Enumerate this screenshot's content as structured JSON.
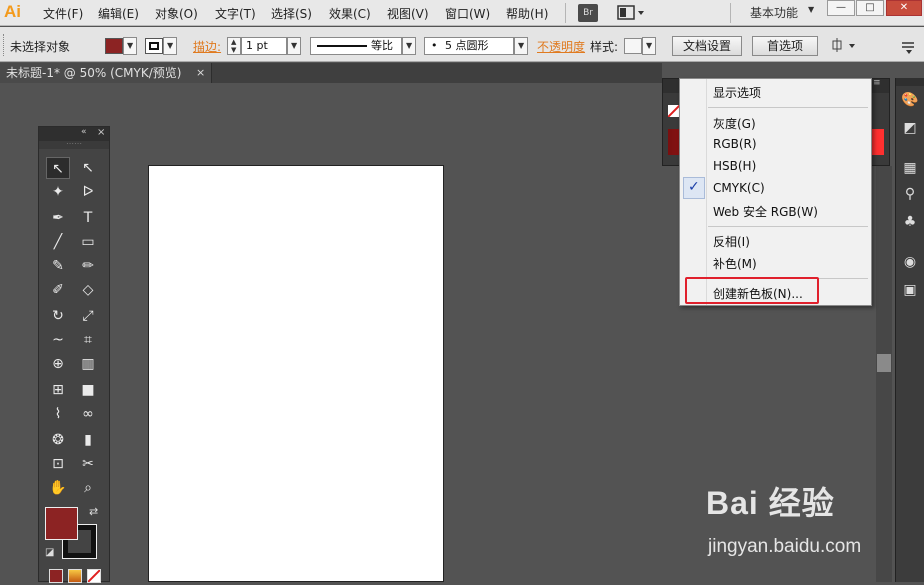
{
  "app": {
    "logo": "Ai"
  },
  "menubar": {
    "items": [
      "文件(F)",
      "编辑(E)",
      "对象(O)",
      "文字(T)",
      "选择(S)",
      "效果(C)",
      "视图(V)",
      "窗口(W)",
      "帮助(H)"
    ],
    "bridge_label": "Br",
    "workspace": "基本功能",
    "window_buttons": [
      "—",
      "□",
      "✕"
    ]
  },
  "control_bar": {
    "selection_status": "未选择对象",
    "fill_color": "#8c2323",
    "stroke_label": "描边:",
    "stroke_weight": "1 pt",
    "stroke_profile": "等比",
    "brush_label": "5 点圆形",
    "opacity_label": "不透明度",
    "style_label": "样式:",
    "doc_setup_button": "文档设置",
    "prefs_button": "首选项"
  },
  "document_tab": {
    "title": "未标题-1* @ 50% (CMYK/预览)",
    "close": "×"
  },
  "tools": {
    "rows": [
      [
        "selection-tool",
        "direct-selection-tool"
      ],
      [
        "magic-wand-tool",
        "lasso-tool"
      ],
      [
        "pen-tool",
        "type-tool"
      ],
      [
        "line-tool",
        "rectangle-tool"
      ],
      [
        "paintbrush-tool",
        "pencil-tool"
      ],
      [
        "blob-brush-tool",
        "eraser-tool"
      ],
      [
        "rotate-tool",
        "scale-tool"
      ],
      [
        "warp-tool",
        "free-transform-tool"
      ],
      [
        "shape-builder-tool",
        "graph-tool"
      ],
      [
        "mesh-tool",
        "gradient-tool"
      ],
      [
        "eyedropper-tool",
        "blend-tool"
      ],
      [
        "symbol-sprayer-tool",
        "column-graph-tool"
      ],
      [
        "artboard-tool",
        "slice-tool"
      ],
      [
        "hand-tool",
        "zoom-tool"
      ]
    ],
    "glyphs": [
      [
        "↖",
        "↖"
      ],
      [
        "✦",
        "ᐅ"
      ],
      [
        "✒",
        "T"
      ],
      [
        "╱",
        "▭"
      ],
      [
        "✎",
        "✏"
      ],
      [
        "✐",
        "◇"
      ],
      [
        "↻",
        "⤢"
      ],
      [
        "~",
        "⌗"
      ],
      [
        "⊕",
        "▥"
      ],
      [
        "⊞",
        "■"
      ],
      [
        "⌇",
        "∞"
      ],
      [
        "❂",
        "▮"
      ],
      [
        "⊡",
        "✂"
      ],
      [
        "✋",
        "⌕"
      ]
    ],
    "fill_color": "#8c2323",
    "stroke_color": "#111111"
  },
  "color_menu": {
    "items": [
      {
        "label": "显示选项"
      },
      {
        "label": "灰度(G)"
      },
      {
        "label": "RGB(R)"
      },
      {
        "label": "HSB(H)"
      },
      {
        "label": "CMYK(C)",
        "checked": true
      },
      {
        "label": "Web 安全 RGB(W)"
      },
      {
        "label": "反相(I)"
      },
      {
        "label": "补色(M)"
      },
      {
        "label": "创建新色板(N)...",
        "highlighted": true
      }
    ],
    "check_glyph": "✓"
  },
  "right_dock": {
    "icons": [
      "color-palette-icon",
      "color-guide-icon",
      "swatches-icon",
      "brushes-icon",
      "symbols-icon",
      "stroke-icon",
      "transparency-icon"
    ],
    "glyphs": [
      "🎨",
      "◩",
      "▦",
      "⚲",
      "♣",
      "◉",
      "▣"
    ]
  },
  "watermark": {
    "main": "Bai 经验",
    "sub": "jingyan.baidu.com"
  }
}
